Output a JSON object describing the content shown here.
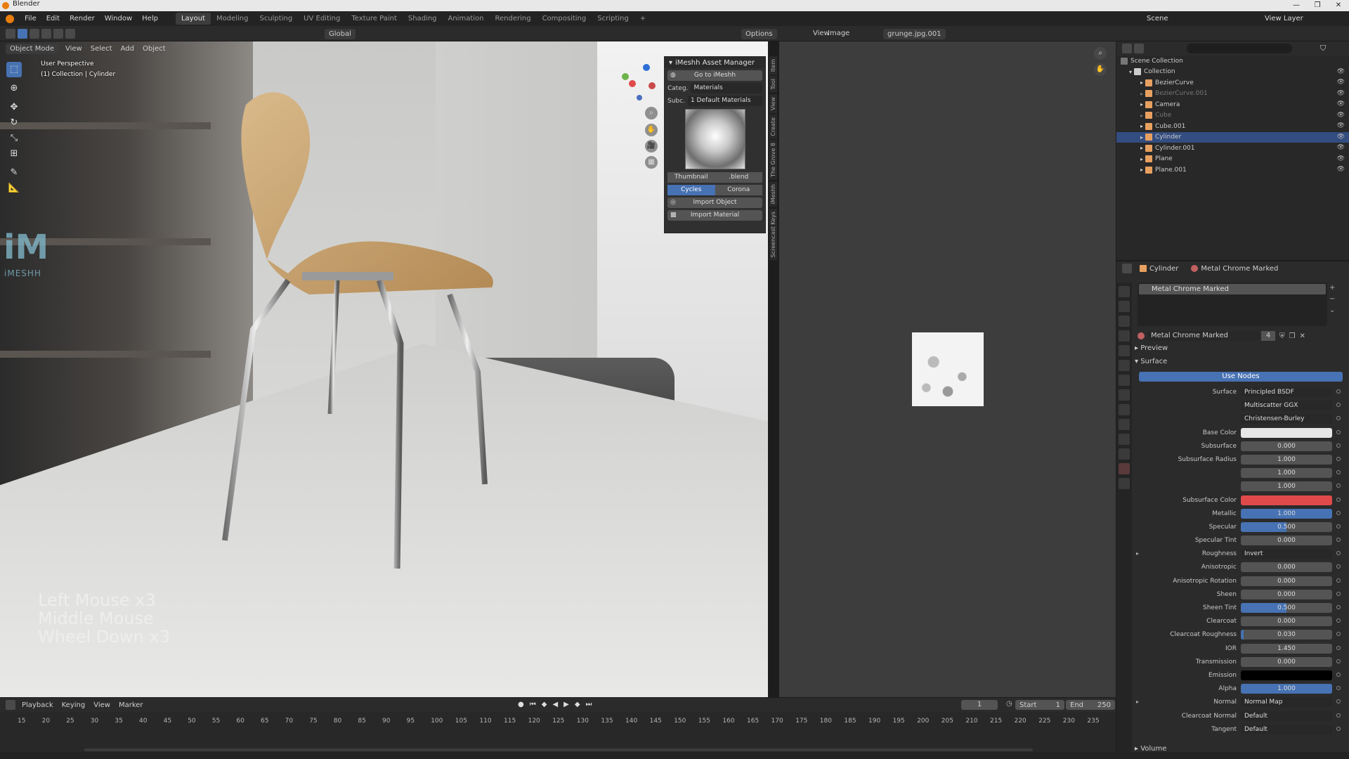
{
  "window": {
    "title": "Blender",
    "controls": [
      "—",
      "❐",
      "✕"
    ]
  },
  "menubar": {
    "menus": [
      "File",
      "Edit",
      "Render",
      "Window",
      "Help"
    ],
    "workspaces": [
      "Layout",
      "Modeling",
      "Sculpting",
      "UV Editing",
      "Texture Paint",
      "Shading",
      "Animation",
      "Rendering",
      "Compositing",
      "Scripting"
    ],
    "active_workspace": "Layout",
    "add_tab": "+",
    "scene_label": "Scene",
    "view_layer_label": "View Layer"
  },
  "viewport_header": {
    "mode": "Object Mode",
    "menus": [
      "View",
      "Select",
      "Add",
      "Object"
    ],
    "transform_orientation": "Global",
    "options_label": "Options"
  },
  "viewport": {
    "perspective_label": "User Perspective",
    "collection_label": "(1) Collection | Cylinder",
    "logo_text": "iM",
    "logo_sub": "iMESHH",
    "shortcut_lines": [
      "Left Mouse x3",
      "Middle Mouse",
      "Wheel Down x3"
    ]
  },
  "imeshh_panel": {
    "title": "iMeshh Asset Manager",
    "goto_button": "Go to iMeshh",
    "category_label": "Categ.",
    "category_value": "Materials",
    "subcategory_label": "Subc.",
    "subcategory_value": "1 Default Materials",
    "thumbnail_button": "Thumbnail",
    "blend_button": ".blend",
    "renderers": [
      "Cycles",
      "Corona"
    ],
    "active_renderer": "Cycles",
    "import_object": "Import Object",
    "import_material": "Import Material"
  },
  "side_tabs": [
    "Item",
    "Tool",
    "View",
    "Create",
    "The Grove 8",
    "iMeshh",
    "Screencast Keys"
  ],
  "image_editor": {
    "menus": [
      "View",
      "Image"
    ],
    "image_name": "grunge.jpg.001"
  },
  "outliner": {
    "root": "Scene Collection",
    "collection": "Collection",
    "items": [
      {
        "name": "BezierCurve",
        "dim": false,
        "selected": false,
        "color": "#e8a060"
      },
      {
        "name": "BezierCurve.001",
        "dim": true,
        "selected": false,
        "color": "#e8a060"
      },
      {
        "name": "Camera",
        "dim": false,
        "selected": false,
        "color": "#e8a060"
      },
      {
        "name": "Cube",
        "dim": true,
        "selected": false,
        "color": "#e8a060"
      },
      {
        "name": "Cube.001",
        "dim": false,
        "selected": false,
        "color": "#e8a060"
      },
      {
        "name": "Cylinder",
        "dim": false,
        "selected": true,
        "color": "#e8a060"
      },
      {
        "name": "Cylinder.001",
        "dim": false,
        "selected": false,
        "color": "#e8a060"
      },
      {
        "name": "Plane",
        "dim": false,
        "selected": false,
        "color": "#e8a060"
      },
      {
        "name": "Plane.001",
        "dim": false,
        "selected": false,
        "color": "#e8a060"
      }
    ]
  },
  "properties": {
    "breadcrumb_object": "Cylinder",
    "breadcrumb_material": "Metal Chrome Marked",
    "slot_name": "Metal Chrome Marked",
    "material_name": "Metal Chrome Marked",
    "user_count": "4",
    "preview_label": "Preview",
    "surface_label": "Surface",
    "use_nodes_label": "Use Nodes",
    "volume_label": "Volume",
    "rows": [
      {
        "label": "Surface",
        "value": "Principled BSDF",
        "kind": "dd"
      },
      {
        "label": "",
        "value": "Multiscatter GGX",
        "kind": "dd"
      },
      {
        "label": "",
        "value": "Christensen-Burley",
        "kind": "dd"
      },
      {
        "label": "Base Color",
        "value": "",
        "kind": "color",
        "color": "#e6e6e6"
      },
      {
        "label": "Subsurface",
        "value": "0.000",
        "kind": "num",
        "fill": 0
      },
      {
        "label": "Subsurface Radius",
        "value": "1.000",
        "kind": "num",
        "fill": 0
      },
      {
        "label": "",
        "value": "1.000",
        "kind": "num",
        "fill": 0
      },
      {
        "label": "",
        "value": "1.000",
        "kind": "num",
        "fill": 0
      },
      {
        "label": "Subsurface Color",
        "value": "",
        "kind": "color",
        "color": "#e04a4a"
      },
      {
        "label": "Metallic",
        "value": "1.000",
        "kind": "num",
        "fill": 1
      },
      {
        "label": "Specular",
        "value": "0.500",
        "kind": "num",
        "fill": 0.5
      },
      {
        "label": "Specular Tint",
        "value": "0.000",
        "kind": "num",
        "fill": 0
      },
      {
        "label": "Roughness",
        "value": "Invert",
        "kind": "dd",
        "expand": true
      },
      {
        "label": "Anisotropic",
        "value": "0.000",
        "kind": "num",
        "fill": 0
      },
      {
        "label": "Anisotropic Rotation",
        "value": "0.000",
        "kind": "num",
        "fill": 0
      },
      {
        "label": "Sheen",
        "value": "0.000",
        "kind": "num",
        "fill": 0
      },
      {
        "label": "Sheen Tint",
        "value": "0.500",
        "kind": "num",
        "fill": 0.5
      },
      {
        "label": "Clearcoat",
        "value": "0.000",
        "kind": "num",
        "fill": 0
      },
      {
        "label": "Clearcoat Roughness",
        "value": "0.030",
        "kind": "num",
        "fill": 0.03
      },
      {
        "label": "IOR",
        "value": "1.450",
        "kind": "num",
        "fill": 0
      },
      {
        "label": "Transmission",
        "value": "0.000",
        "kind": "num",
        "fill": 0
      },
      {
        "label": "Emission",
        "value": "",
        "kind": "color",
        "color": "#000000"
      },
      {
        "label": "Alpha",
        "value": "1.000",
        "kind": "num",
        "fill": 1
      },
      {
        "label": "Normal",
        "value": "Normal Map",
        "kind": "dd",
        "expand": true
      },
      {
        "label": "Clearcoat Normal",
        "value": "Default",
        "kind": "dd"
      },
      {
        "label": "Tangent",
        "value": "Default",
        "kind": "dd"
      }
    ]
  },
  "timeline": {
    "menus": [
      "Playback",
      "Keying",
      "View",
      "Marker"
    ],
    "current_frame": "1",
    "start_label": "Start",
    "start_value": "1",
    "end_label": "End",
    "end_value": "250",
    "ticks": [
      "15",
      "20",
      "25",
      "30",
      "35",
      "40",
      "45",
      "50",
      "55",
      "60",
      "65",
      "70",
      "75",
      "80",
      "85",
      "90",
      "95",
      "100",
      "105",
      "110",
      "115",
      "120",
      "125",
      "130",
      "135",
      "140",
      "145",
      "150",
      "155",
      "160",
      "165",
      "170",
      "175",
      "180",
      "185",
      "190",
      "195",
      "200",
      "205",
      "210",
      "215",
      "220",
      "225",
      "230",
      "235"
    ]
  }
}
